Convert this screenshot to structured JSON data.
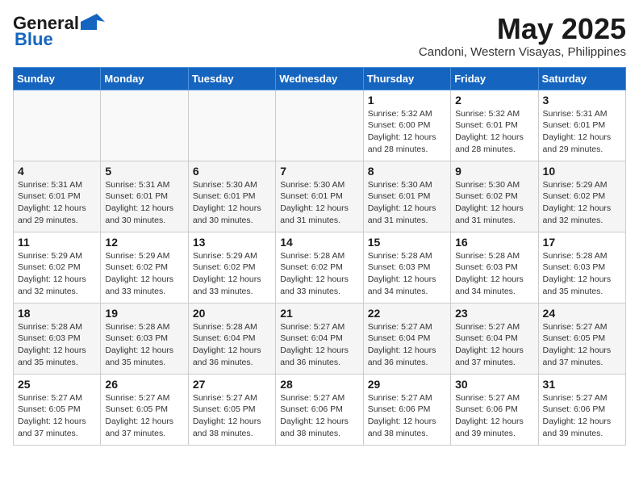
{
  "header": {
    "logo_line1": "General",
    "logo_line2": "Blue",
    "month_year": "May 2025",
    "location": "Candoni, Western Visayas, Philippines"
  },
  "weekdays": [
    "Sunday",
    "Monday",
    "Tuesday",
    "Wednesday",
    "Thursday",
    "Friday",
    "Saturday"
  ],
  "weeks": [
    [
      {
        "day": "",
        "info": ""
      },
      {
        "day": "",
        "info": ""
      },
      {
        "day": "",
        "info": ""
      },
      {
        "day": "",
        "info": ""
      },
      {
        "day": "1",
        "info": "Sunrise: 5:32 AM\nSunset: 6:00 PM\nDaylight: 12 hours\nand 28 minutes."
      },
      {
        "day": "2",
        "info": "Sunrise: 5:32 AM\nSunset: 6:01 PM\nDaylight: 12 hours\nand 28 minutes."
      },
      {
        "day": "3",
        "info": "Sunrise: 5:31 AM\nSunset: 6:01 PM\nDaylight: 12 hours\nand 29 minutes."
      }
    ],
    [
      {
        "day": "4",
        "info": "Sunrise: 5:31 AM\nSunset: 6:01 PM\nDaylight: 12 hours\nand 29 minutes."
      },
      {
        "day": "5",
        "info": "Sunrise: 5:31 AM\nSunset: 6:01 PM\nDaylight: 12 hours\nand 30 minutes."
      },
      {
        "day": "6",
        "info": "Sunrise: 5:30 AM\nSunset: 6:01 PM\nDaylight: 12 hours\nand 30 minutes."
      },
      {
        "day": "7",
        "info": "Sunrise: 5:30 AM\nSunset: 6:01 PM\nDaylight: 12 hours\nand 31 minutes."
      },
      {
        "day": "8",
        "info": "Sunrise: 5:30 AM\nSunset: 6:01 PM\nDaylight: 12 hours\nand 31 minutes."
      },
      {
        "day": "9",
        "info": "Sunrise: 5:30 AM\nSunset: 6:02 PM\nDaylight: 12 hours\nand 31 minutes."
      },
      {
        "day": "10",
        "info": "Sunrise: 5:29 AM\nSunset: 6:02 PM\nDaylight: 12 hours\nand 32 minutes."
      }
    ],
    [
      {
        "day": "11",
        "info": "Sunrise: 5:29 AM\nSunset: 6:02 PM\nDaylight: 12 hours\nand 32 minutes."
      },
      {
        "day": "12",
        "info": "Sunrise: 5:29 AM\nSunset: 6:02 PM\nDaylight: 12 hours\nand 33 minutes."
      },
      {
        "day": "13",
        "info": "Sunrise: 5:29 AM\nSunset: 6:02 PM\nDaylight: 12 hours\nand 33 minutes."
      },
      {
        "day": "14",
        "info": "Sunrise: 5:28 AM\nSunset: 6:02 PM\nDaylight: 12 hours\nand 33 minutes."
      },
      {
        "day": "15",
        "info": "Sunrise: 5:28 AM\nSunset: 6:03 PM\nDaylight: 12 hours\nand 34 minutes."
      },
      {
        "day": "16",
        "info": "Sunrise: 5:28 AM\nSunset: 6:03 PM\nDaylight: 12 hours\nand 34 minutes."
      },
      {
        "day": "17",
        "info": "Sunrise: 5:28 AM\nSunset: 6:03 PM\nDaylight: 12 hours\nand 35 minutes."
      }
    ],
    [
      {
        "day": "18",
        "info": "Sunrise: 5:28 AM\nSunset: 6:03 PM\nDaylight: 12 hours\nand 35 minutes."
      },
      {
        "day": "19",
        "info": "Sunrise: 5:28 AM\nSunset: 6:03 PM\nDaylight: 12 hours\nand 35 minutes."
      },
      {
        "day": "20",
        "info": "Sunrise: 5:28 AM\nSunset: 6:04 PM\nDaylight: 12 hours\nand 36 minutes."
      },
      {
        "day": "21",
        "info": "Sunrise: 5:27 AM\nSunset: 6:04 PM\nDaylight: 12 hours\nand 36 minutes."
      },
      {
        "day": "22",
        "info": "Sunrise: 5:27 AM\nSunset: 6:04 PM\nDaylight: 12 hours\nand 36 minutes."
      },
      {
        "day": "23",
        "info": "Sunrise: 5:27 AM\nSunset: 6:04 PM\nDaylight: 12 hours\nand 37 minutes."
      },
      {
        "day": "24",
        "info": "Sunrise: 5:27 AM\nSunset: 6:05 PM\nDaylight: 12 hours\nand 37 minutes."
      }
    ],
    [
      {
        "day": "25",
        "info": "Sunrise: 5:27 AM\nSunset: 6:05 PM\nDaylight: 12 hours\nand 37 minutes."
      },
      {
        "day": "26",
        "info": "Sunrise: 5:27 AM\nSunset: 6:05 PM\nDaylight: 12 hours\nand 37 minutes."
      },
      {
        "day": "27",
        "info": "Sunrise: 5:27 AM\nSunset: 6:05 PM\nDaylight: 12 hours\nand 38 minutes."
      },
      {
        "day": "28",
        "info": "Sunrise: 5:27 AM\nSunset: 6:06 PM\nDaylight: 12 hours\nand 38 minutes."
      },
      {
        "day": "29",
        "info": "Sunrise: 5:27 AM\nSunset: 6:06 PM\nDaylight: 12 hours\nand 38 minutes."
      },
      {
        "day": "30",
        "info": "Sunrise: 5:27 AM\nSunset: 6:06 PM\nDaylight: 12 hours\nand 39 minutes."
      },
      {
        "day": "31",
        "info": "Sunrise: 5:27 AM\nSunset: 6:06 PM\nDaylight: 12 hours\nand 39 minutes."
      }
    ]
  ]
}
